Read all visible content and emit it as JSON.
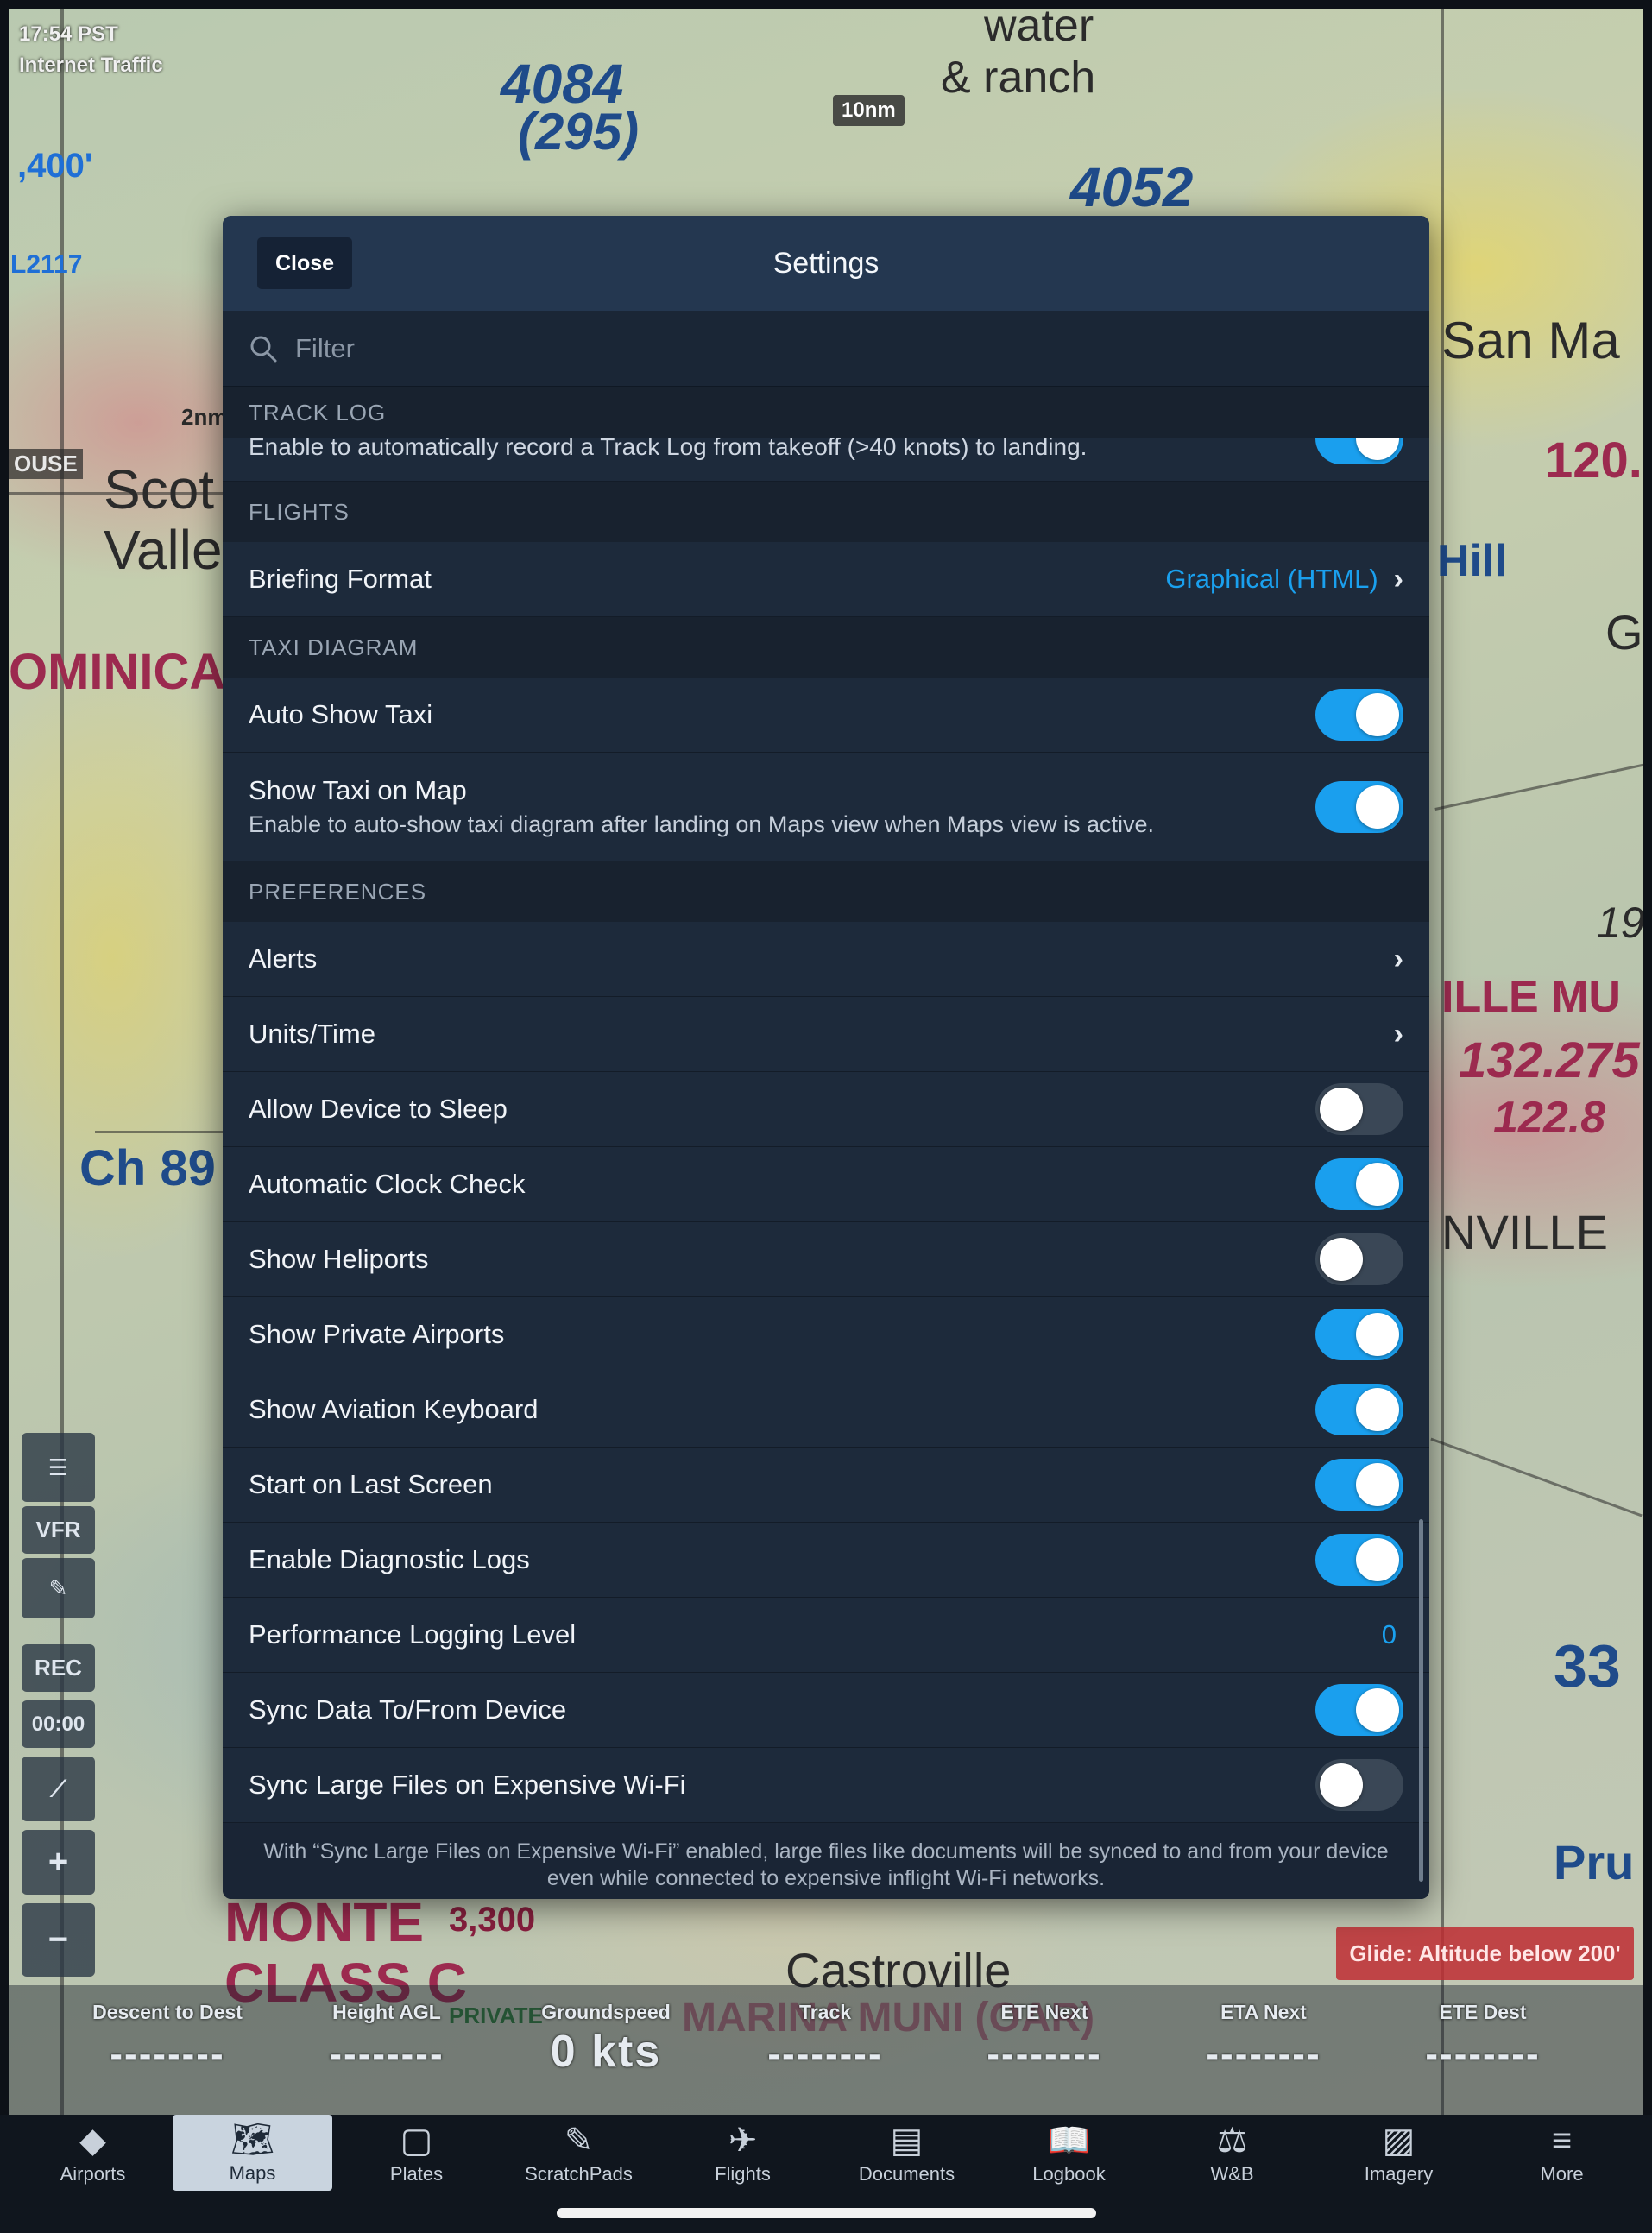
{
  "status": {
    "time": "17:54 PST",
    "traffic": "Internet Traffic"
  },
  "map": {
    "labels": [
      "4084",
      "(295)",
      "water",
      "& ranch",
      "4052",
      "San Ma",
      "Scot",
      "Valle",
      "OMINICA",
      "120.",
      "Hill",
      "ILLE MU",
      "132.275",
      "122.8",
      "NVILLE",
      "Ch 89",
      "33",
      "Pru",
      "Castroville",
      "MARINA MUNI (OAR)",
      "MONTE",
      "CLASS C",
      "3,300",
      "PRIVATE",
      "19",
      ",400'",
      "L2117",
      "2nm",
      "OUSE",
      "G"
    ],
    "scale": "10nm",
    "glide_alert": "Glide: Altitude below 200'"
  },
  "tools": {
    "vfr": "VFR",
    "rec": "REC",
    "timer": "00:00",
    "zoom_in": "+",
    "zoom_out": "−"
  },
  "instruments": [
    {
      "label": "Descent to Dest",
      "value": "--------"
    },
    {
      "label": "Height AGL",
      "value": "--------"
    },
    {
      "label": "Groundspeed",
      "value": "0 kts"
    },
    {
      "label": "Track",
      "value": "--------"
    },
    {
      "label": "ETE Next",
      "value": "--------"
    },
    {
      "label": "ETA Next",
      "value": "--------"
    },
    {
      "label": "ETE Dest",
      "value": "--------"
    }
  ],
  "tabs": [
    {
      "label": "Airports",
      "icon": "airports-icon",
      "glyph": "◆"
    },
    {
      "label": "Maps",
      "icon": "maps-icon",
      "glyph": "🗺"
    },
    {
      "label": "Plates",
      "icon": "plates-icon",
      "glyph": "▢"
    },
    {
      "label": "ScratchPads",
      "icon": "scratchpads-icon",
      "glyph": "✎"
    },
    {
      "label": "Flights",
      "icon": "flights-icon",
      "glyph": "✈"
    },
    {
      "label": "Documents",
      "icon": "documents-icon",
      "glyph": "▤"
    },
    {
      "label": "Logbook",
      "icon": "logbook-icon",
      "glyph": "📖"
    },
    {
      "label": "W&B",
      "icon": "weight-balance-icon",
      "glyph": "⚖"
    },
    {
      "label": "Imagery",
      "icon": "imagery-icon",
      "glyph": "▨"
    },
    {
      "label": "More",
      "icon": "more-icon",
      "glyph": "≡"
    }
  ],
  "settings": {
    "title": "Settings",
    "close_label": "Close",
    "filter_placeholder": "Filter",
    "track_log": {
      "header": "TRACK LOG",
      "desc": "Enable to automatically record a Track Log from takeoff (>40 knots) to landing.",
      "on": true
    },
    "flights": {
      "header": "FLIGHTS",
      "briefing_label": "Briefing Format",
      "briefing_value": "Graphical (HTML)"
    },
    "taxi": {
      "header": "TAXI DIAGRAM",
      "auto_show_label": "Auto Show Taxi",
      "auto_show_on": true,
      "show_on_map_label": "Show Taxi on Map",
      "show_on_map_desc": "Enable to auto-show taxi diagram after landing on Maps view when Maps view is active.",
      "show_on_map_on": true
    },
    "preferences": {
      "header": "PREFERENCES",
      "alerts_label": "Alerts",
      "units_label": "Units/Time",
      "items": [
        {
          "label": "Allow Device to Sleep",
          "on": false
        },
        {
          "label": "Automatic Clock Check",
          "on": true
        },
        {
          "label": "Show Heliports",
          "on": false
        },
        {
          "label": "Show Private Airports",
          "on": true
        },
        {
          "label": "Show Aviation Keyboard",
          "on": true
        },
        {
          "label": "Start on Last Screen",
          "on": true
        },
        {
          "label": "Enable Diagnostic Logs",
          "on": true
        }
      ],
      "perf_label": "Performance Logging Level",
      "perf_value": "0",
      "sync_items": [
        {
          "label": "Sync Data To/From Device",
          "on": true
        },
        {
          "label": "Sync Large Files on Expensive Wi-Fi",
          "on": false
        }
      ],
      "footnote": "With “Sync Large Files on Expensive Wi-Fi” enabled, large files like documents will be synced to and from your device even while connected to expensive inflight Wi-Fi networks."
    }
  },
  "colors": {
    "accent": "#1a9fee",
    "modal_bg": "#1c2838",
    "header_bg": "#243750",
    "glide_alert": "#be2d32"
  }
}
